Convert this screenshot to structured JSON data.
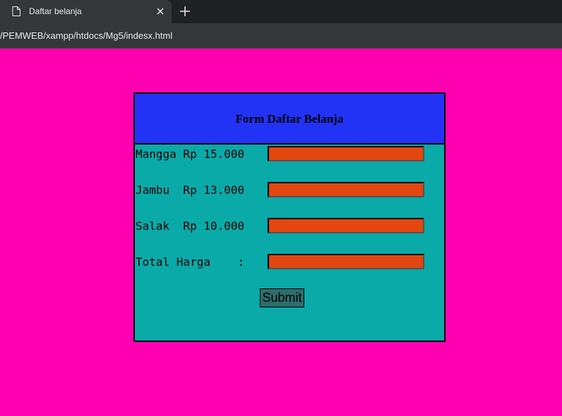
{
  "browser": {
    "tab_title": "Daftar belanja",
    "address": "/PEMWEB/xampp/htdocs/Mg5/indesx.html"
  },
  "form": {
    "title": "Form Daftar Belanja",
    "rows": [
      {
        "label": "Mangga Rp 15.000",
        "value": ""
      },
      {
        "label": "Jambu  Rp 13.000",
        "value": ""
      },
      {
        "label": "Salak  Rp 10.000",
        "value": ""
      },
      {
        "label": "Total Harga    :",
        "value": ""
      }
    ],
    "submit_label": "Submit"
  },
  "colors": {
    "page_background": "#ff00b0",
    "header_background": "#2233f5",
    "form_background": "#0aaaa9",
    "input_background": "#e2470f",
    "button_background": "#2e6d6b"
  },
  "icons": {
    "tab_icon": "document-icon",
    "tab_close": "close-icon",
    "new_tab": "plus-icon"
  }
}
